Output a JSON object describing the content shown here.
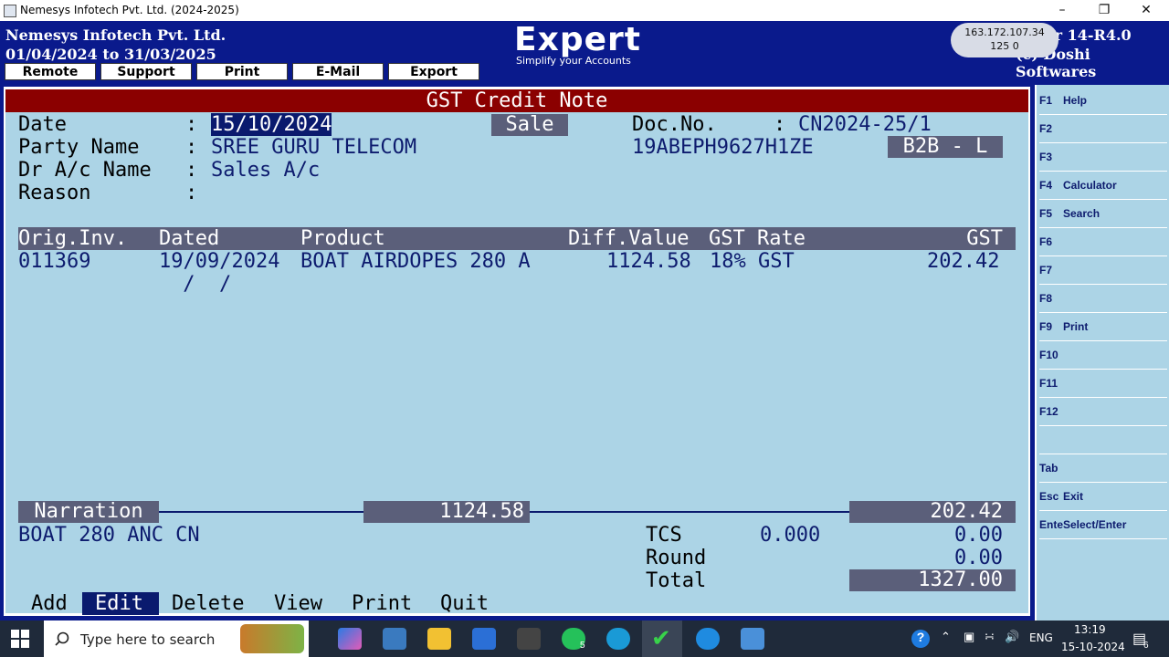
{
  "window": {
    "title": "Nemesys Infotech Pvt. Ltd. (2024-2025)"
  },
  "header": {
    "company": "Nemesys Infotech Pvt. Ltd.",
    "period": "01/04/2024 to 31/03/2025",
    "buttons": [
      "Remote",
      "Support",
      "Print",
      "E-Mail",
      "Export"
    ],
    "brand": "Expert",
    "tagline": "Simplify your Accounts",
    "ip": "163.172.107.34",
    "ip_sub": "125 0",
    "version": "a) Ver 14-R4.0",
    "copyright": "(c) Doshi Softwares"
  },
  "form": {
    "title": "GST Credit Note",
    "date_label": "Date",
    "date_value": "15/10/2024",
    "type_badge": "Sale",
    "docno_label": "Doc.No.",
    "docno_value": "CN2024-25/1",
    "party_label": "Party Name",
    "party_value": "SREE GURU TELECOM",
    "gstin": "19ABEPH9627H1ZE",
    "category_badge": "B2B - L",
    "dr_label": "Dr A/c Name",
    "dr_value": "Sales A/c",
    "reason_label": "Reason",
    "colon": ":"
  },
  "table": {
    "headers": {
      "orig": "Orig.Inv.",
      "dated": "Dated",
      "product": "Product",
      "diff": "Diff.Value",
      "rate": "GST Rate",
      "gst": "GST"
    },
    "rows": [
      {
        "orig": "011369",
        "dated": "19/09/2024",
        "product": "BOAT AIRDOPES 280 A",
        "diff": "1124.58",
        "rate": "18% GST",
        "gst": "202.42"
      },
      {
        "orig": "",
        "dated": " /  /",
        "product": "",
        "diff": "",
        "rate": "",
        "gst": ""
      }
    ]
  },
  "footer": {
    "narration_label": "Narration",
    "diff_total": "1124.58",
    "gst_total": "202.42",
    "narration_text": "BOAT 280 ANC CN",
    "tcs_label": "TCS",
    "tcs_rate": "0.000",
    "tcs_value": "0.00",
    "round_label": "Round",
    "round_value": "0.00",
    "total_label": "Total",
    "total_value": "1327.00"
  },
  "menu": [
    "Add",
    "Edit",
    "Delete",
    "View",
    "Print",
    "Quit"
  ],
  "fkeys": [
    {
      "key": "F1",
      "action": "Help"
    },
    {
      "key": "F2",
      "action": ""
    },
    {
      "key": "F3",
      "action": ""
    },
    {
      "key": "F4",
      "action": "Calculator"
    },
    {
      "key": "F5",
      "action": "Search"
    },
    {
      "key": "F6",
      "action": ""
    },
    {
      "key": "F7",
      "action": ""
    },
    {
      "key": "F8",
      "action": ""
    },
    {
      "key": "F9",
      "action": "Print"
    },
    {
      "key": "F10",
      "action": ""
    },
    {
      "key": "F11",
      "action": ""
    },
    {
      "key": "F12",
      "action": ""
    },
    {
      "key": "",
      "action": ""
    },
    {
      "key": "Tab",
      "action": ""
    },
    {
      "key": "Esc",
      "action": "Exit"
    },
    {
      "key": "Ente",
      "action": "Select/Enter"
    }
  ],
  "taskbar": {
    "search_placeholder": "Type here to search",
    "whatsapp_badge": "5",
    "lang": "ENG",
    "time": "13:19",
    "date": "15-10-2024",
    "notif_count": "6"
  },
  "colors": {
    "header_bg": "#0a1a8c",
    "panel_bg": "#acd4e6",
    "title_bar": "#8b0000",
    "grey_bar": "#5b5f7a",
    "selected_menu": "#0a1a6e"
  }
}
